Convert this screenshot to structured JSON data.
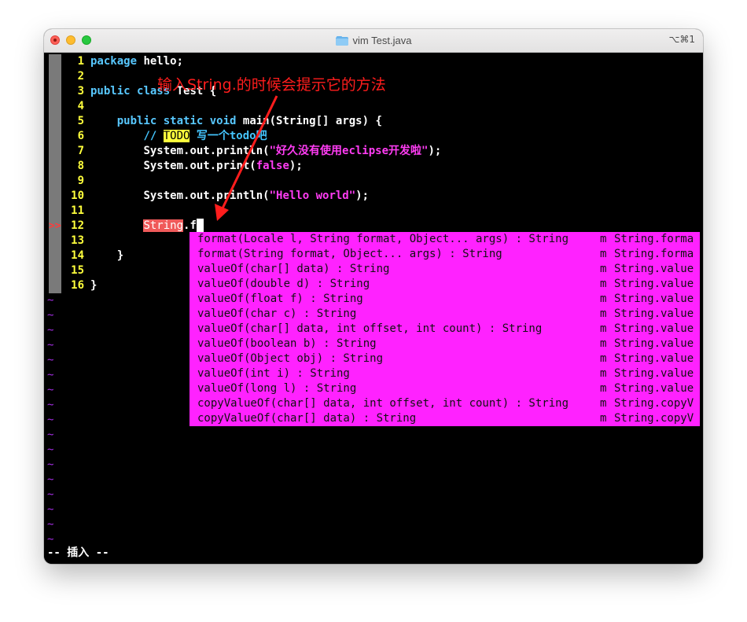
{
  "window": {
    "title": "vim Test.java",
    "shortcut": "⌥⌘1"
  },
  "editor": {
    "lines": [
      {
        "num": "1",
        "indent": "",
        "parts": [
          {
            "t": "package",
            "c": "kw"
          },
          {
            "t": " hello;",
            "c": ""
          }
        ]
      },
      {
        "num": "2",
        "indent": "",
        "parts": []
      },
      {
        "num": "3",
        "indent": "",
        "parts": [
          {
            "t": "public",
            "c": "kw"
          },
          {
            "t": " ",
            "c": ""
          },
          {
            "t": "class",
            "c": "kw"
          },
          {
            "t": " Test {",
            "c": ""
          }
        ]
      },
      {
        "num": "4",
        "indent": "",
        "parts": []
      },
      {
        "num": "5",
        "indent": "    ",
        "parts": [
          {
            "t": "public",
            "c": "kw"
          },
          {
            "t": " ",
            "c": ""
          },
          {
            "t": "static",
            "c": "kw"
          },
          {
            "t": " ",
            "c": ""
          },
          {
            "t": "void",
            "c": "kw"
          },
          {
            "t": " main(String[] args) {",
            "c": ""
          }
        ]
      },
      {
        "num": "6",
        "indent": "        ",
        "parts": [
          {
            "t": "// ",
            "c": "cmt"
          },
          {
            "t": "TODO",
            "c": "todo"
          },
          {
            "t": " 写一个todo吧",
            "c": "cmt"
          }
        ]
      },
      {
        "num": "7",
        "indent": "        ",
        "parts": [
          {
            "t": "System.out.println(",
            "c": ""
          },
          {
            "t": "\"好久没有使用eclipse开发啦\"",
            "c": "str"
          },
          {
            "t": ");",
            "c": ""
          }
        ]
      },
      {
        "num": "8",
        "indent": "        ",
        "parts": [
          {
            "t": "System.out.print(",
            "c": ""
          },
          {
            "t": "false",
            "c": "str"
          },
          {
            "t": ");",
            "c": ""
          }
        ]
      },
      {
        "num": "9",
        "indent": "",
        "parts": []
      },
      {
        "num": "10",
        "indent": "        ",
        "parts": [
          {
            "t": "System.out.println(",
            "c": ""
          },
          {
            "t": "\"Hello world\"",
            "c": "str"
          },
          {
            "t": ");",
            "c": ""
          }
        ]
      },
      {
        "num": "11",
        "indent": "",
        "parts": []
      },
      {
        "num": "12",
        "indent": "        ",
        "parts": [
          {
            "t": "String",
            "c": "hl"
          },
          {
            "t": ".f",
            "c": ""
          },
          {
            "t": "",
            "c": "cursor"
          }
        ]
      },
      {
        "num": "13",
        "indent": "",
        "parts": []
      },
      {
        "num": "14",
        "indent": "    ",
        "parts": [
          {
            "t": "}",
            "c": ""
          }
        ]
      },
      {
        "num": "15",
        "indent": "",
        "parts": []
      },
      {
        "num": "16",
        "indent": "",
        "parts": [
          {
            "t": "}",
            "c": ""
          }
        ]
      }
    ],
    "sign_marker": ">>",
    "sign_line": "12",
    "tilde": "~",
    "tilde_count": 17
  },
  "completion": {
    "kind": "m",
    "items": [
      {
        "label": "format(Locale l, String format, Object... args) : String",
        "menu": "String.forma"
      },
      {
        "label": "format(String format, Object... args) : String",
        "menu": "String.forma"
      },
      {
        "label": "valueOf(char[] data) : String",
        "menu": "String.value"
      },
      {
        "label": "valueOf(double d) : String",
        "menu": "String.value"
      },
      {
        "label": "valueOf(float f) : String",
        "menu": "String.value"
      },
      {
        "label": "valueOf(char c) : String",
        "menu": "String.value"
      },
      {
        "label": "valueOf(char[] data, int offset, int count) : String",
        "menu": "String.value"
      },
      {
        "label": "valueOf(boolean b) : String",
        "menu": "String.value"
      },
      {
        "label": "valueOf(Object obj) : String",
        "menu": "String.value"
      },
      {
        "label": "valueOf(int i) : String",
        "menu": "String.value"
      },
      {
        "label": "valueOf(long l) : String",
        "menu": "String.value"
      },
      {
        "label": "copyValueOf(char[] data, int offset, int count) : String",
        "menu": "String.copyV"
      },
      {
        "label": "copyValueOf(char[] data) : String",
        "menu": "String.copyV"
      }
    ]
  },
  "status_line": "-- 插入 --",
  "annotation": {
    "text": "输入String.的时候会提示它的方法",
    "color": "#ff1d1d"
  }
}
